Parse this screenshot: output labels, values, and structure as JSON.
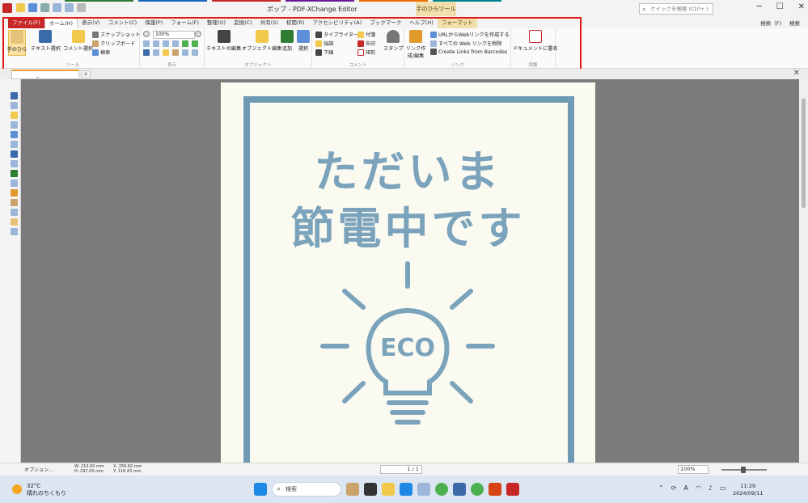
{
  "window": {
    "title": "ポップ - PDF-XChange Editor",
    "context_group": "手のひらツール",
    "search_placeholder": "クイックを検索 (Ctrl+.)",
    "controls": [
      "─",
      "☐",
      "✕"
    ]
  },
  "menu": {
    "file": "ファイル(F)",
    "tabs": [
      "ホーム(H)",
      "表示(V)",
      "コメント(C)",
      "保護(P)",
      "フォーム(F)",
      "整理(O)",
      "変換(C)",
      "共有(S)",
      "校閲(R)",
      "アクセシビリティ(A)",
      "ブックマーク",
      "ヘルプ(H)"
    ],
    "format": "フォーマット",
    "right": [
      "検索（F)",
      "検索"
    ]
  },
  "ribbon": {
    "tool": {
      "label": "ツール",
      "hand": "手のひら",
      "select_text": "テキスト選択",
      "select_comment": "コメント選択",
      "snapshot": "スナップショット",
      "clipboard": "クリップボード",
      "search": "検索"
    },
    "view": {
      "label": "表示",
      "zoom": "100%"
    },
    "objects": {
      "label": "オブジェクト",
      "edit_text": "テキストの編集",
      "edit_object": "オブジェクト編集",
      "add": "追加",
      "select": "選択"
    },
    "comments": {
      "label": "コメント",
      "typewriter": "タイプライター",
      "note": "付箋",
      "highlight": "強調",
      "arrow": "矢印",
      "underline": "下線",
      "rect": "矩形",
      "stamp": "スタンプ"
    },
    "links": {
      "label": "リンク",
      "create": "リンク作成/編集",
      "from_url": "URLからWebリンクを作成する",
      "remove_all": "すべての Web リンクを削除",
      "barcodes": "Create Links from Barcodes"
    },
    "sign": {
      "label": "保護",
      "sign_doc": "ドキュメントに署名"
    }
  },
  "doc_tab": {
    "name": "_",
    "add": "+",
    "close": "✕"
  },
  "poster": {
    "line1": "ただいま",
    "line2": "節電中です",
    "bulb_text": "ECO",
    "color": "#7ba3bc",
    "frame_color": "#6f9ab4",
    "bg": "#fbfaf1"
  },
  "status": {
    "options": "オプション...",
    "size": "W: 210.00 mm\nH: 297.00 mm",
    "cursor": "X: 259.82 mm\nY: 116.43 mm",
    "page": "1 / 1",
    "zoom": "100%"
  },
  "taskbar": {
    "temp": "32°C",
    "weather": "晴れのちくもり",
    "search": "検索",
    "time": "11:29",
    "date": "2024/09/11"
  }
}
